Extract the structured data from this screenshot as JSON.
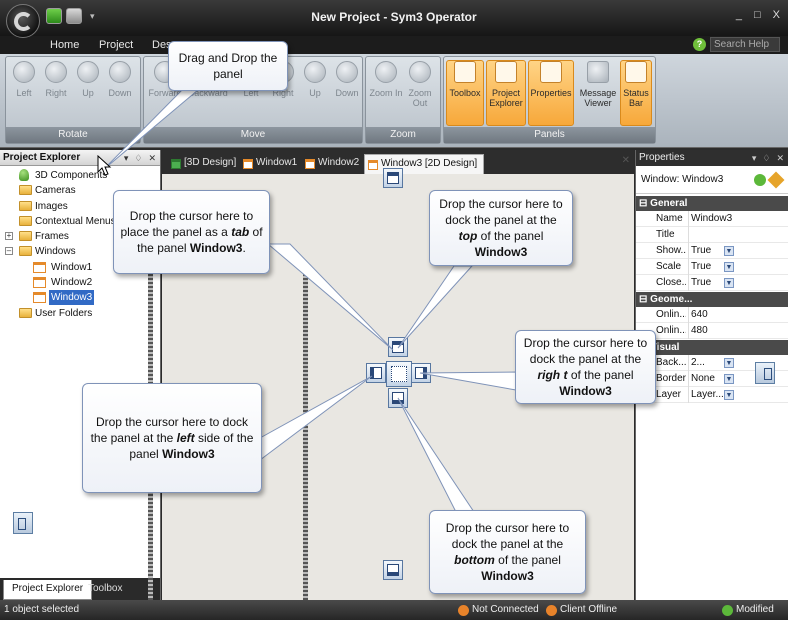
{
  "window": {
    "title": "New Project - Sym3 Operator",
    "controls": [
      "_",
      "□",
      "X"
    ]
  },
  "ribbon_tabs": [
    "Home",
    "Project",
    "Des"
  ],
  "help": {
    "placeholder": "Search Help"
  },
  "ribbon": {
    "groups": [
      {
        "label": "Rotate",
        "buttons": [
          "Left",
          "Right",
          "Up",
          "Down"
        ]
      },
      {
        "label": "Move",
        "buttons": [
          "Forward",
          "Backward",
          "Left",
          "Right",
          "Up",
          "Down"
        ]
      },
      {
        "label": "Zoom",
        "buttons": [
          "Zoom In",
          "Zoom Out"
        ]
      },
      {
        "label": "Panels",
        "buttons": [
          "Toolbox",
          "Project Explorer",
          "Properties",
          "Message Viewer",
          "Status Bar"
        ]
      }
    ]
  },
  "project_explorer": {
    "title": "Project Explorer",
    "items": [
      "3D Components",
      "Cameras",
      "Images",
      "Contextual Menus",
      "Frames",
      "Windows",
      "Window1",
      "Window2",
      "Window3",
      "User Folders"
    ],
    "tabs": [
      "Project Explorer",
      "Toolbox"
    ]
  },
  "doc_tabs": [
    "[3D Design]",
    "Window1",
    "Window2",
    "Window3 [2D Design]"
  ],
  "properties": {
    "title": "Properties",
    "object": "Window: Window3",
    "categories": [
      "General",
      "Geome...",
      "Visual"
    ],
    "general": [
      {
        "name": "Name",
        "value": "Window3"
      },
      {
        "name": "Title",
        "value": ""
      },
      {
        "name": "Show...",
        "value": "True"
      },
      {
        "name": "Scale",
        "value": "True"
      },
      {
        "name": "Close...",
        "value": "True"
      }
    ],
    "geometry": [
      {
        "name": "Onlin...",
        "value": "640"
      },
      {
        "name": "Onlin...",
        "value": "480"
      }
    ],
    "visual": [
      {
        "name": "Back...",
        "value": "2..."
      },
      {
        "name": "Border",
        "value": "None"
      },
      {
        "name": "Layer",
        "value": "Layer..."
      }
    ]
  },
  "statusbar": {
    "left": "1 object selected",
    "connection": "Not Connected",
    "client": "Client Offline",
    "modified": "Modified"
  },
  "callouts": {
    "drag": "Drag and Drop the panel",
    "tab_pre": "Drop the cursor here to place the panel as a",
    "tab_em": "tab",
    "tab_post": "of the panel",
    "top_pre": "Drop the cursor here to dock the panel at the",
    "top_em": "top",
    "top_post": "of the panel",
    "right_pre": "Drop the cursor here to dock the panel at the",
    "right_em": "righ t",
    "right_post": "of the panel",
    "left_pre": "Drop the cursor here to dock the panel at the",
    "left_em": "left",
    "left_post": "side of the panel",
    "bottom_pre": "Drop the cursor here to dock the panel at the",
    "bottom_em": "bottom",
    "bottom_post": "of the panel",
    "panel_name": "Window3"
  }
}
